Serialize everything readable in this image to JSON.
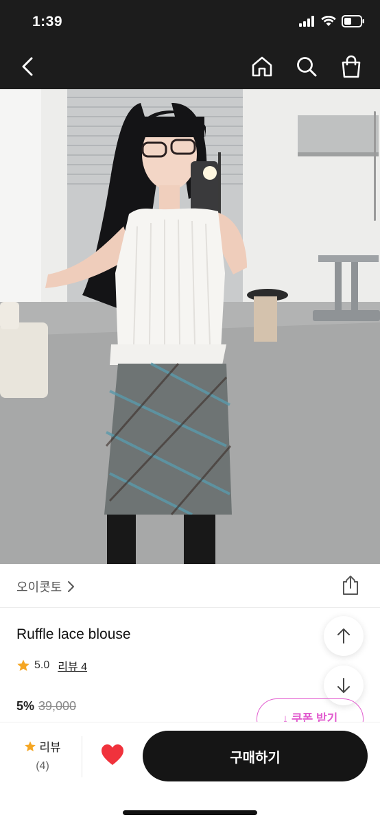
{
  "status_bar": {
    "time": "1:39"
  },
  "nav": {
    "back_icon": "chevron-left-icon",
    "home_icon": "home-icon",
    "search_icon": "search-icon",
    "bag_icon": "shopping-bag-icon"
  },
  "hero_image": {
    "description_icon": "product-photo"
  },
  "brand": {
    "name": "오이콧토"
  },
  "product": {
    "title": "Ruffle lace blouse",
    "rating": "5.0",
    "review_link": "리뷰 4",
    "discount": "5%",
    "original_price": "39,000"
  },
  "coupon": {
    "label": "↓ 쿠폰 받기"
  },
  "bottom_bar": {
    "review_label": "리뷰",
    "review_count": "(4)",
    "buy_label": "구매하기"
  },
  "colors": {
    "accent_pink": "#e25ccf",
    "star": "#f5a623",
    "heart": "#f0323c",
    "dark": "#151515"
  }
}
